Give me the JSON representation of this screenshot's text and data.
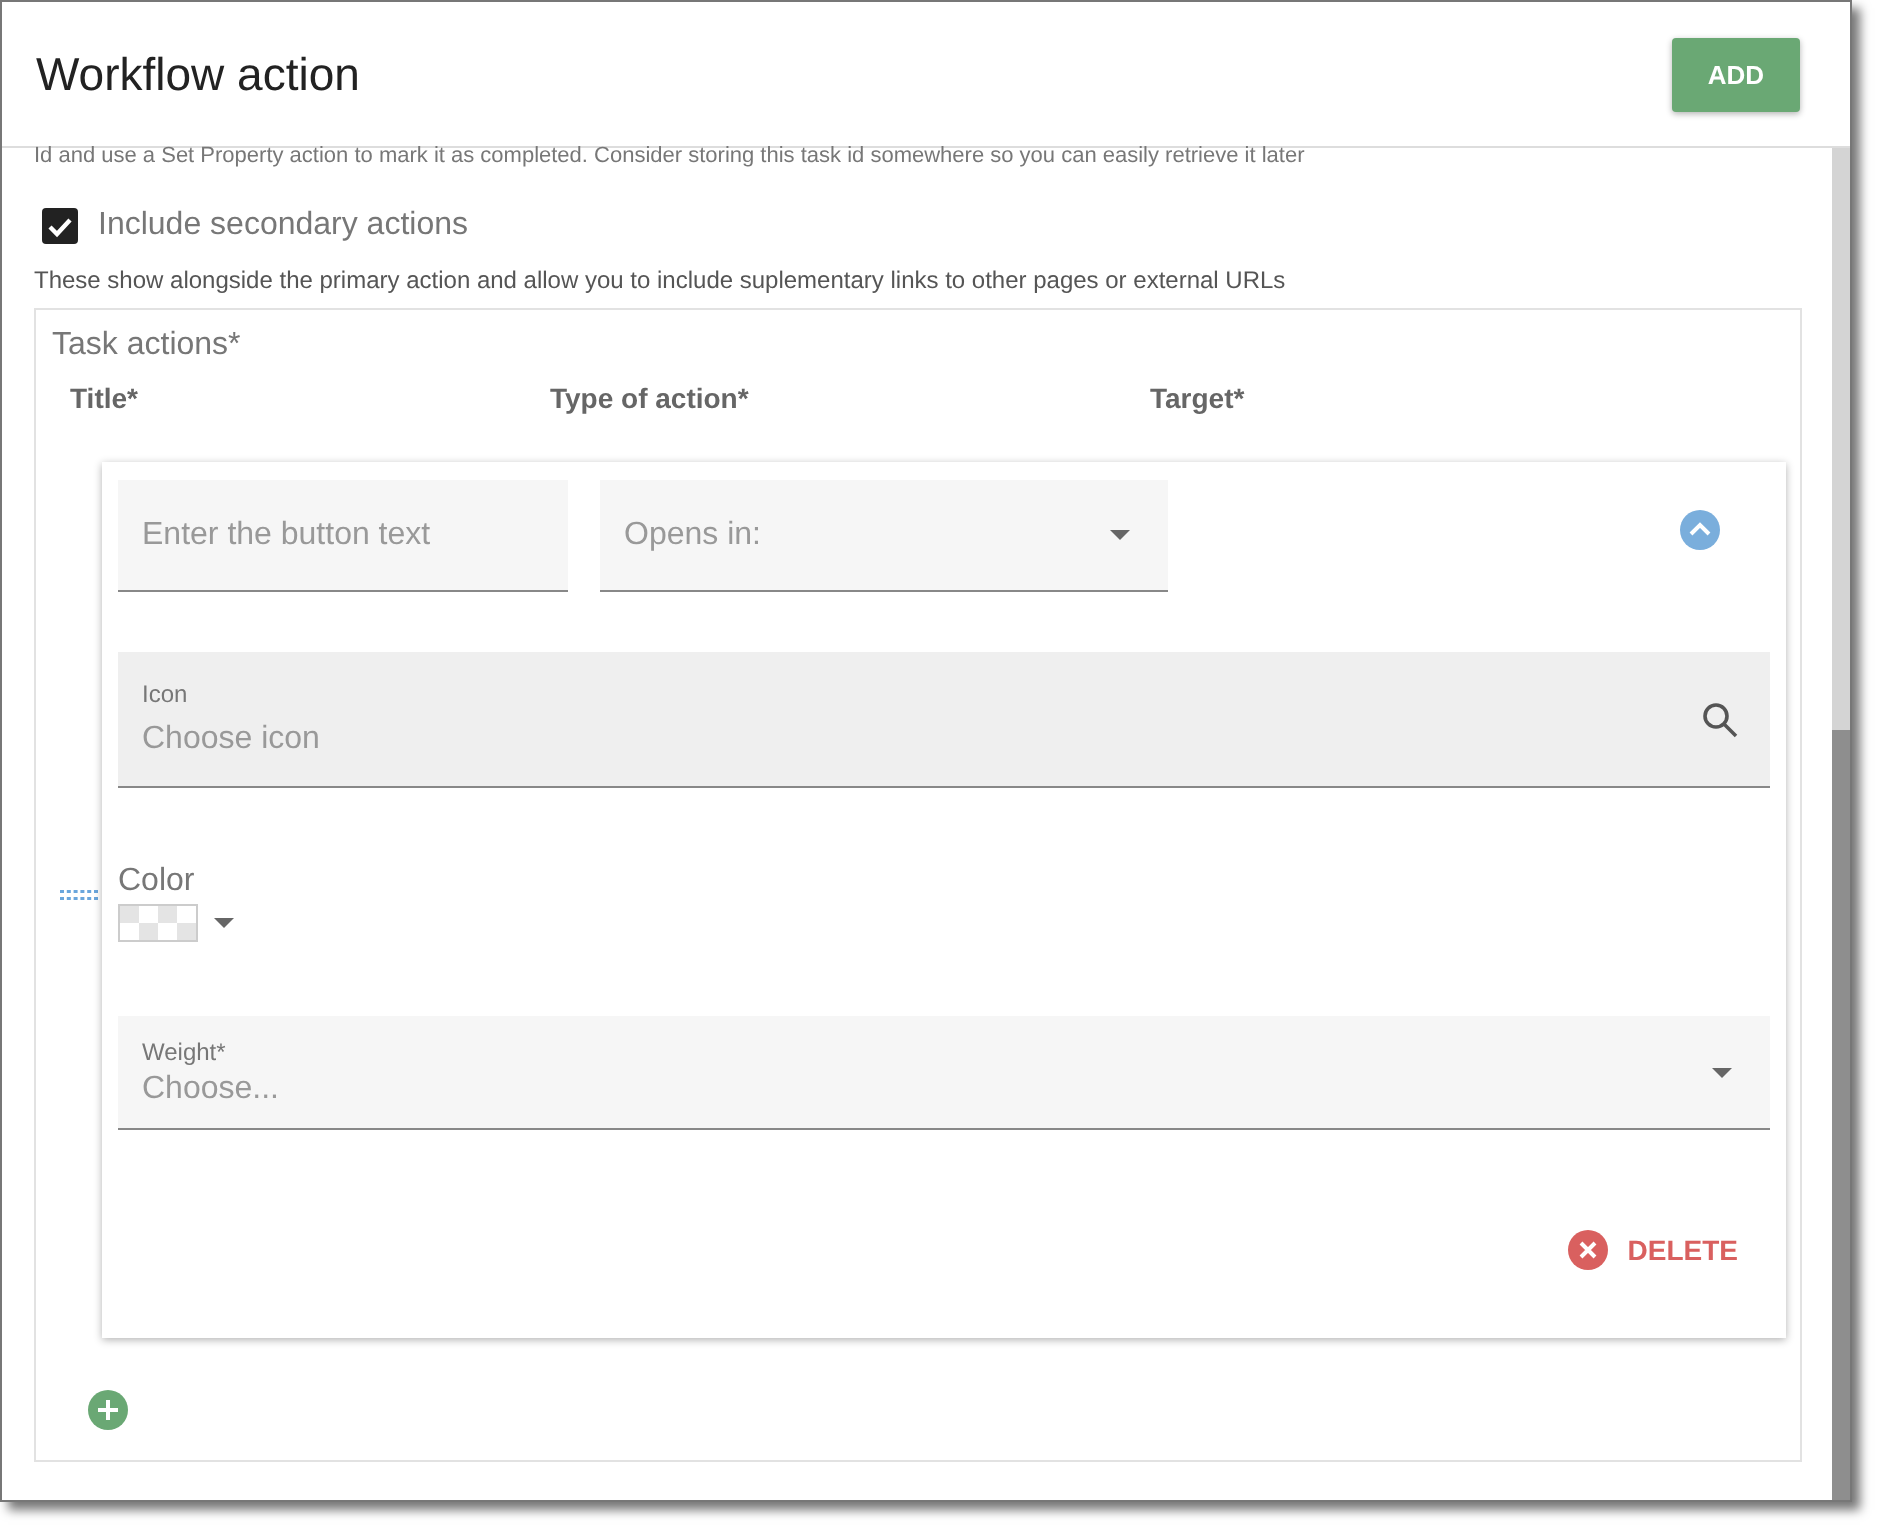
{
  "dialog": {
    "title": "Workflow action",
    "add_button": "ADD"
  },
  "intro_text": "Id and use a Set Property action to mark it as completed. Consider storing this task id somewhere so you can easily retrieve it later",
  "secondary_actions": {
    "label": "Include secondary actions",
    "checked": true,
    "description": "These show alongside the primary action and allow you to include suplementary links to other pages or external URLs"
  },
  "task_actions": {
    "label": "Task actions*",
    "columns": [
      "Title*",
      "Type of action*",
      "Target*"
    ],
    "items": [
      {
        "expanded": true,
        "title_field": {
          "placeholder": "Enter the button text"
        },
        "type_field": {
          "placeholder": "Opens in:"
        },
        "icon_field": {
          "label": "Icon",
          "placeholder": "Choose icon"
        },
        "color_field": {
          "label": "Color"
        },
        "weight_field": {
          "label": "Weight*",
          "placeholder": "Choose..."
        },
        "delete_button": "DELETE"
      }
    ]
  }
}
